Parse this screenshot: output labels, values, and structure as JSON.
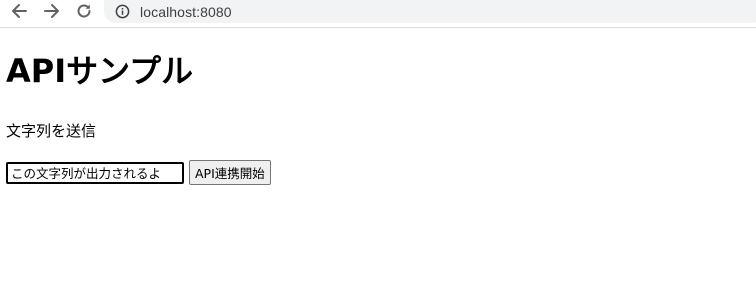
{
  "browser": {
    "url": "localhost:8080"
  },
  "main": {
    "heading": "APIサンプル",
    "subtitle": "文字列を送信",
    "input_value": "この文字列が出力されるよ",
    "button_label": "API連携開始"
  }
}
